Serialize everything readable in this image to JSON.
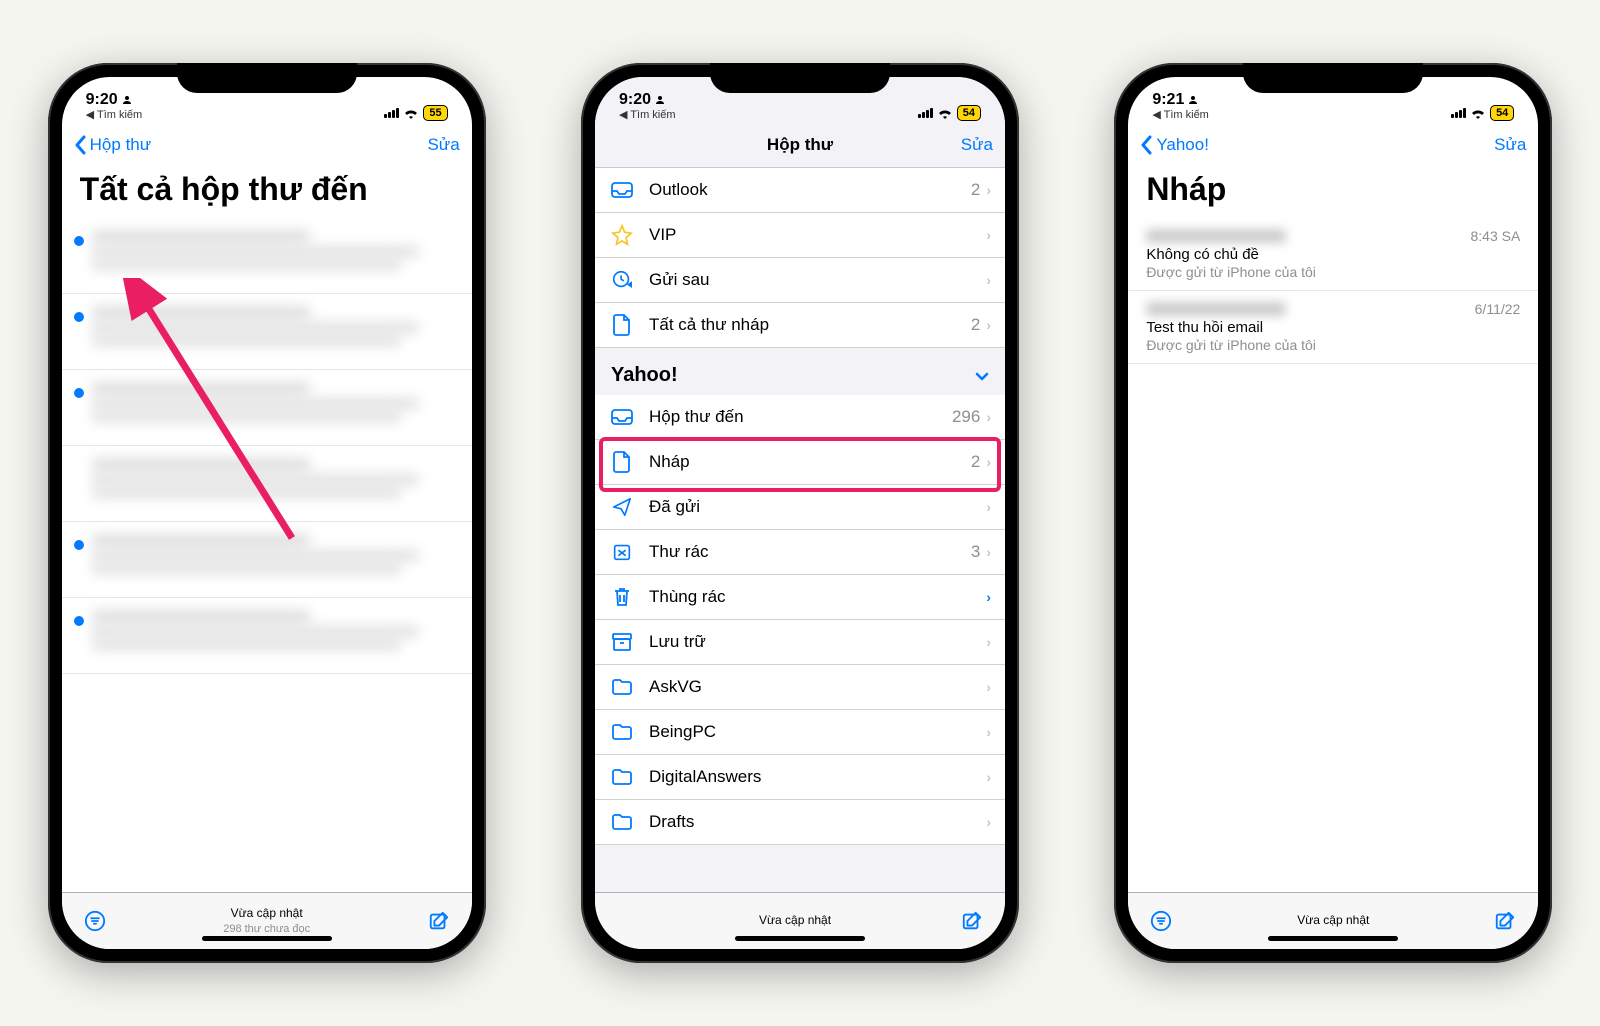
{
  "phones": [
    {
      "status": {
        "time": "9:20",
        "breadcrumb": "◀ Tìm kiếm",
        "battery": "55"
      },
      "nav": {
        "back": "Hộp thư",
        "edit": "Sửa",
        "center": ""
      },
      "title": "Tất cả hộp thư đến",
      "toolbar": {
        "line1": "Vừa cập nhật",
        "line2": "298 thư chưa đọc"
      }
    },
    {
      "status": {
        "time": "9:20",
        "breadcrumb": "◀ Tìm kiếm",
        "battery": "54"
      },
      "nav": {
        "back": "",
        "edit": "Sửa",
        "center": "Hộp thư"
      },
      "topRows": [
        {
          "icon": "inbox",
          "label": "Outlook",
          "count": "2"
        },
        {
          "icon": "star",
          "label": "VIP",
          "count": ""
        },
        {
          "icon": "clock",
          "label": "Gửi sau",
          "count": ""
        },
        {
          "icon": "doc",
          "label": "Tất cả thư nháp",
          "count": "2"
        }
      ],
      "section": "Yahoo!",
      "yahooRows": [
        {
          "icon": "inbox",
          "label": "Hộp thư đến",
          "count": "296"
        },
        {
          "icon": "doc",
          "label": "Nháp",
          "count": "2",
          "highlight": true
        },
        {
          "icon": "sent",
          "label": "Đã gửi",
          "count": ""
        },
        {
          "icon": "junk",
          "label": "Thư rác",
          "count": "3"
        },
        {
          "icon": "trash",
          "label": "Thùng rác",
          "count": "",
          "blueChevron": true
        },
        {
          "icon": "archive",
          "label": "Lưu trữ",
          "count": ""
        },
        {
          "icon": "folder",
          "label": "AskVG",
          "count": ""
        },
        {
          "icon": "folder",
          "label": "BeingPC",
          "count": ""
        },
        {
          "icon": "folder",
          "label": "DigitalAnswers",
          "count": ""
        },
        {
          "icon": "folder",
          "label": "Drafts",
          "count": ""
        }
      ],
      "toolbar": {
        "line1": "Vừa cập nhật",
        "line2": ""
      }
    },
    {
      "status": {
        "time": "9:21",
        "breadcrumb": "◀ Tìm kiếm",
        "battery": "54"
      },
      "nav": {
        "back": "Yahoo!",
        "edit": "Sửa",
        "center": ""
      },
      "title": "Nháp",
      "drafts": [
        {
          "sender_blur": true,
          "time": "8:43 SA",
          "subject": "Không có chủ đề",
          "preview": "Được gửi từ iPhone của tôi"
        },
        {
          "sender_blur": true,
          "time": "6/11/22",
          "subject": "Test thu hồi email",
          "preview": "Được gửi từ iPhone của tôi"
        }
      ],
      "toolbar": {
        "line1": "Vừa cập nhật",
        "line2": ""
      }
    }
  ]
}
